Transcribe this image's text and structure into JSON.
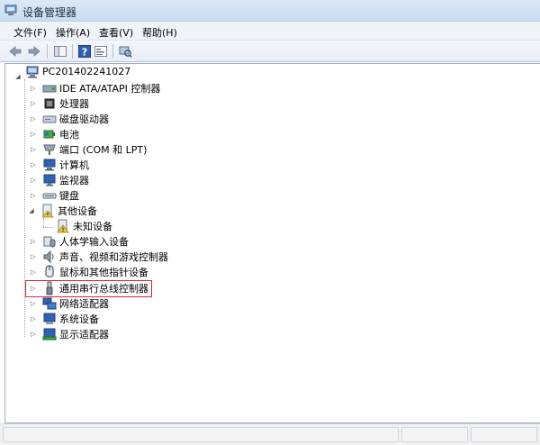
{
  "window": {
    "title": "设备管理器"
  },
  "menu": [
    "文件(F)",
    "操作(A)",
    "查看(V)",
    "帮助(H)"
  ],
  "toolbar": {
    "buttons": [
      "back-arrow-icon",
      "forward-arrow-icon",
      "console-tree-icon",
      "help-icon",
      "properties-icon",
      "scan-hardware-icon"
    ]
  },
  "tree": {
    "root": "PC201402241027",
    "items": [
      "IDE ATA/ATAPI 控制器",
      "处理器",
      "磁盘驱动器",
      "电池",
      "端口 (COM 和 LPT)",
      "计算机",
      "监视器",
      "键盘",
      "其他设备",
      "未知设备",
      "人体学输入设备",
      "声音、视频和游戏控制器",
      "鼠标和其他指针设备",
      "通用串行总线控制器",
      "网络适配器",
      "系统设备",
      "显示适配器"
    ]
  },
  "colors": {
    "highlight_border": "#e0272b"
  }
}
